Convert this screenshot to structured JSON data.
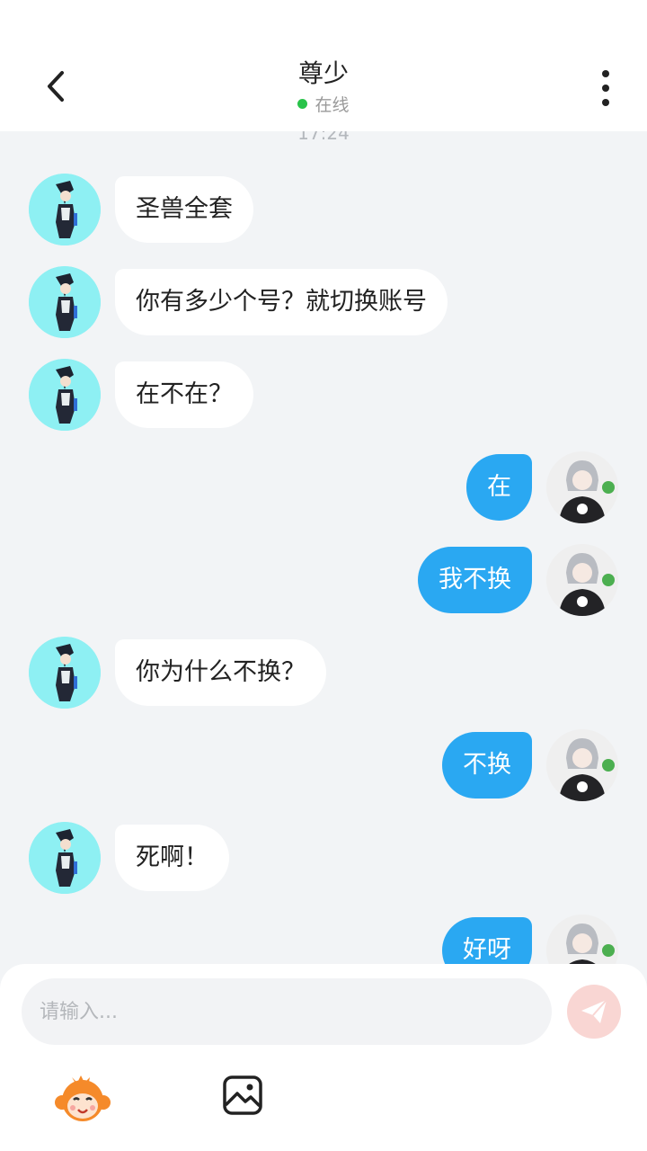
{
  "header": {
    "title": "尊少",
    "status": "在线"
  },
  "chat": {
    "timestamp": "17:24",
    "messages": [
      {
        "side": "left",
        "text": "圣兽全套"
      },
      {
        "side": "left",
        "text": "你有多少个号？就切换账号"
      },
      {
        "side": "left",
        "text": "在不在？"
      },
      {
        "side": "right",
        "text": "在"
      },
      {
        "side": "right",
        "text": "我不换"
      },
      {
        "side": "left",
        "text": "你为什么不换？"
      },
      {
        "side": "right",
        "text": "不换"
      },
      {
        "side": "left",
        "text": "死啊！"
      },
      {
        "side": "right",
        "text": "好呀"
      }
    ]
  },
  "composer": {
    "placeholder": "请输入..."
  },
  "colors": {
    "sent_bubble": "#2aa8f2",
    "received_bubble": "#ffffff",
    "online_dot": "#29c34a",
    "send_button": "#f9d6d3"
  }
}
